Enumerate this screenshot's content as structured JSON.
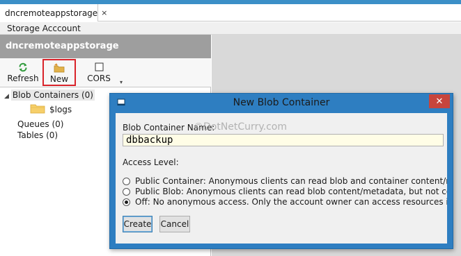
{
  "tab": {
    "title": "dncremoteappstorage",
    "close": "×"
  },
  "menu": {
    "storage_account": "Storage Acccount"
  },
  "panel": {
    "header": "dncremoteappstorage"
  },
  "toolbar": {
    "refresh": "Refresh",
    "new": "New",
    "cors": "CORS"
  },
  "tree": {
    "blob_containers": "Blob Containers (0)",
    "logs": "$logs",
    "queues": "Queues (0)",
    "tables": "Tables (0)"
  },
  "dialog": {
    "title": "New Blob Container",
    "close": "✕",
    "name_label": "Blob Container Name:",
    "watermark": "©DotNetCurry.com",
    "name_value": "dbbackup",
    "access_label": "Access Level:",
    "options": [
      {
        "label": "Public Container: Anonymous clients can read blob and container content/metadata",
        "selected": false
      },
      {
        "label": "Public Blob: Anonymous clients can read blob content/metadata, but not container",
        "selected": false
      },
      {
        "label": "Off: No anonymous access. Only the account owner can access resources in this container",
        "selected": true
      }
    ],
    "create": "Create",
    "cancel": "Cancel"
  },
  "colors": {
    "accent": "#3b8fc7",
    "dialog_frame": "#2e7ec1",
    "close_red": "#c7453c",
    "highlight_box": "#d9232a",
    "input_bg": "#fffde6"
  }
}
